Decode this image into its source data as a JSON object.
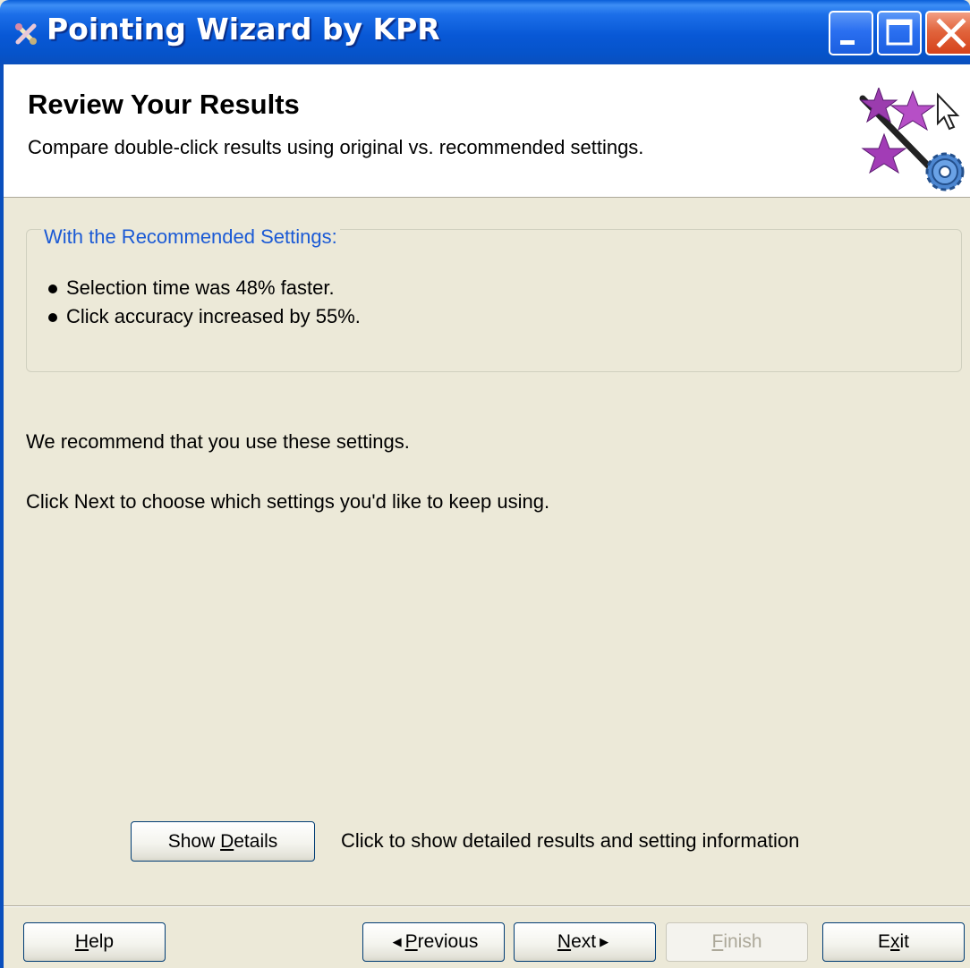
{
  "window": {
    "title": "Pointing Wizard by KPR",
    "app_icon": "kpr-app-icon",
    "controls": [
      "minimize",
      "maximize",
      "close"
    ]
  },
  "header": {
    "title": "Review Your Results",
    "subtitle": "Compare double-click results using original vs. recommended settings.",
    "icon": "magic-wand-stars-gear-icon"
  },
  "results": {
    "group_label": "With the Recommended Settings:",
    "items": [
      "Selection time was 48% faster.",
      "Click accuracy increased by 55%."
    ]
  },
  "body": {
    "recommendation": "We recommend that you use these settings.",
    "instruction": "Click Next to choose which settings you'd like to keep using."
  },
  "details": {
    "button_label_pre": "Show ",
    "button_label_mnemonic": "D",
    "button_label_post": "etails",
    "hint": "Click to show detailed results and setting information"
  },
  "footer": {
    "help": {
      "mnemonic": "H",
      "rest": "elp"
    },
    "previous": {
      "mnemonic": "P",
      "rest": "revious"
    },
    "next": {
      "mnemonic": "N",
      "rest": "ext"
    },
    "finish": {
      "mnemonic": "F",
      "rest": "inish",
      "enabled": false
    },
    "exit": {
      "pre": "E",
      "mnemonic": "x",
      "rest": "it"
    }
  },
  "colors": {
    "titlebar": "#0858d6",
    "dialog_bg": "#ece9d8",
    "group_label": "#1b5ad5",
    "close_button": "#d5421b"
  }
}
